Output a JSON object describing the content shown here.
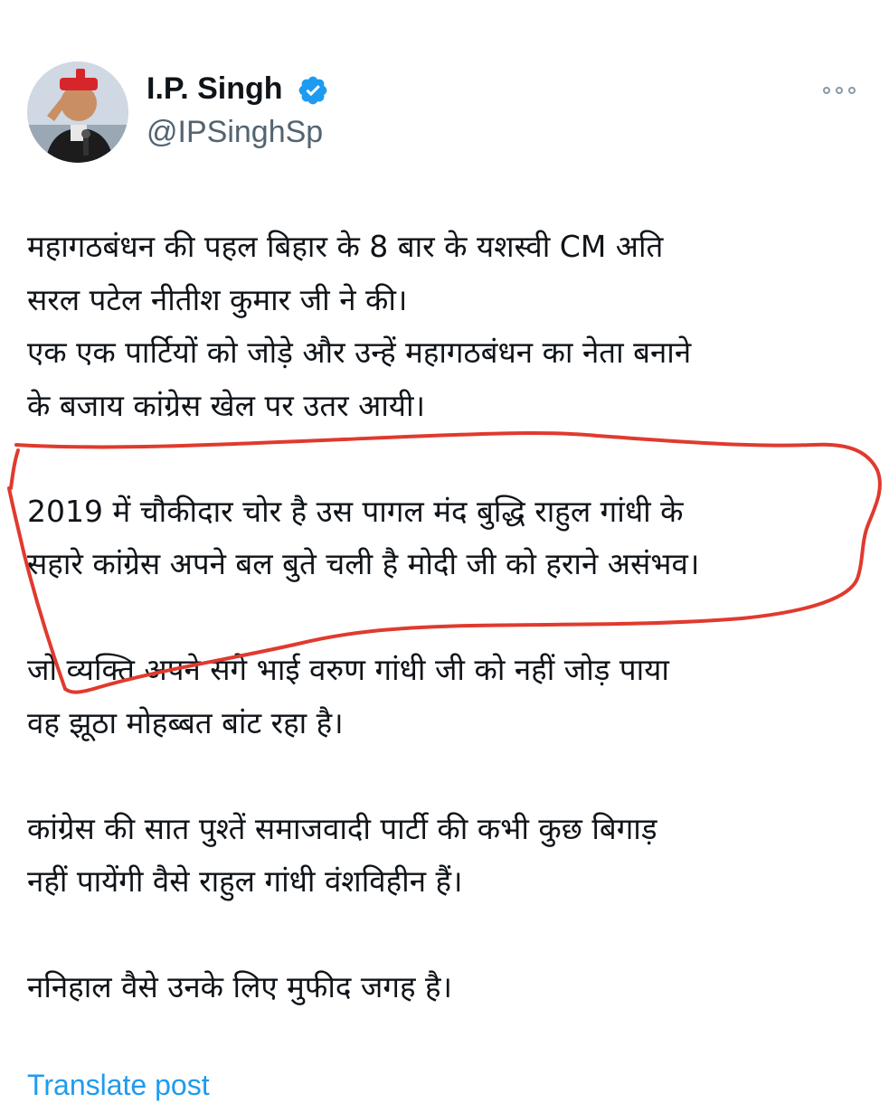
{
  "author": {
    "name": "I.P. Singh",
    "handle": "@IPSinghSp",
    "verified": true
  },
  "tweet": {
    "paragraphs": [
      [
        "महागठबंधन की पहल बिहार के 8 बार के यशस्वी CM अति",
        "सरल पटेल नीतीश कुमार जी ने की।",
        "एक एक पार्टियों को जोड़े और उन्हें महागठबंधन का नेता बनाने",
        "के बजाय कांग्रेस खेल पर उतर आयी।"
      ],
      [
        "2019 में चौकीदार चोर है उस पागल मंद बुद्धि राहुल गांधी के",
        "सहारे कांग्रेस अपने बल बुते चली है मोदी जी को हराने असंभव।"
      ],
      [
        "जो व्यक्ति अपने सगे भाई वरुण गांधी जी को नहीं जोड़ पाया",
        "वह झूठा मोहब्बत बांट रहा है।"
      ],
      [
        "कांग्रेस की सात पुश्तें समाजवादी पार्टी की कभी कुछ बिगाड़",
        "नहीं पायेंगी वैसे राहुल गांधी वंशविहीन हैं।"
      ],
      [
        "ननिहाल वैसे उनके लिए मुफीद जगह है।"
      ]
    ],
    "translate_label": "Translate post"
  },
  "icons": {
    "verified": "verified-badge-icon",
    "more": "more-options-icon"
  },
  "colors": {
    "verified_badge": "#1d9bf0",
    "handle": "#536471",
    "link": "#1d9bf0",
    "annotation": "#e03a2e"
  }
}
